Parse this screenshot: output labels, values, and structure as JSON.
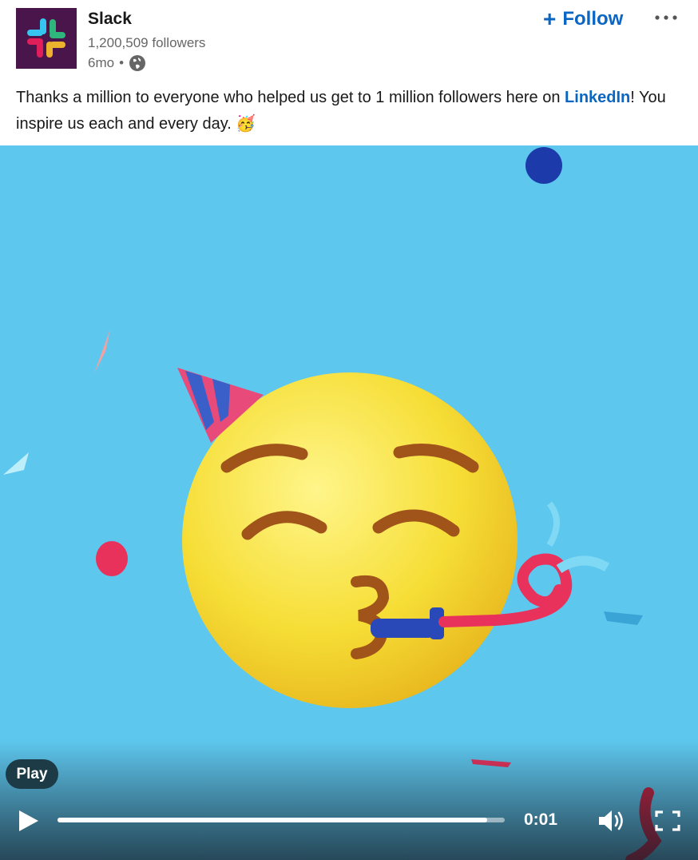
{
  "post": {
    "company_name": "Slack",
    "followers": "1,200,509 followers",
    "age": "6mo",
    "dot": "•",
    "follow_label": "Follow",
    "follow_plus": "+",
    "text_before": "Thanks a million to everyone who helped us get to 1 million followers here on ",
    "mention": "LinkedIn",
    "text_after": "! You inspire us each and every day. ",
    "emoji": "🥳"
  },
  "video": {
    "play_tooltip": "Play",
    "time": "0:01",
    "progress": 0.96
  },
  "colors": {
    "brand": "#4a154b",
    "link": "#0a66c2",
    "video_bg": "#5ec7ee"
  },
  "icons": [
    "slack-logo",
    "globe-icon",
    "more-icon",
    "play-icon",
    "volume-icon",
    "fullscreen-icon"
  ]
}
